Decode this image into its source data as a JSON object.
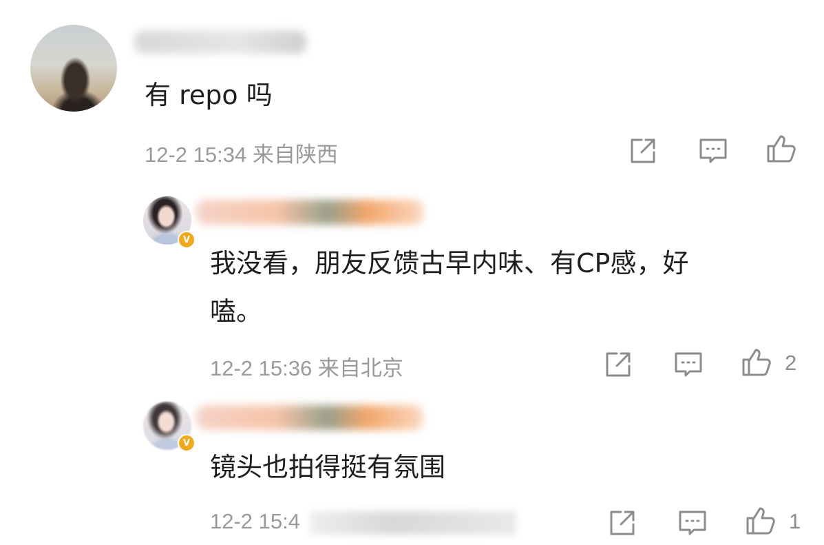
{
  "comments": [
    {
      "text": "有 repo 吗",
      "meta": "12-2 15:34  来自陕西",
      "like_count": ""
    },
    {
      "text_line1": "我没看，朋友反馈古早内味、有CP感，好",
      "text_line2": "嗑。",
      "meta": "12-2 15:36  来自北京",
      "like_count": "2",
      "badge": "V"
    },
    {
      "text": "镜头也拍得挺有氛围",
      "meta": "12-2 15:4",
      "like_count": "1",
      "badge": "V"
    }
  ],
  "icons": {
    "share": "share-icon",
    "comment": "comment-icon",
    "like": "thumbs-up-icon"
  },
  "colors": {
    "verified_badge": "#f2a91c",
    "meta_text": "#9a9a9a",
    "icon_stroke": "#8c8c8c"
  }
}
